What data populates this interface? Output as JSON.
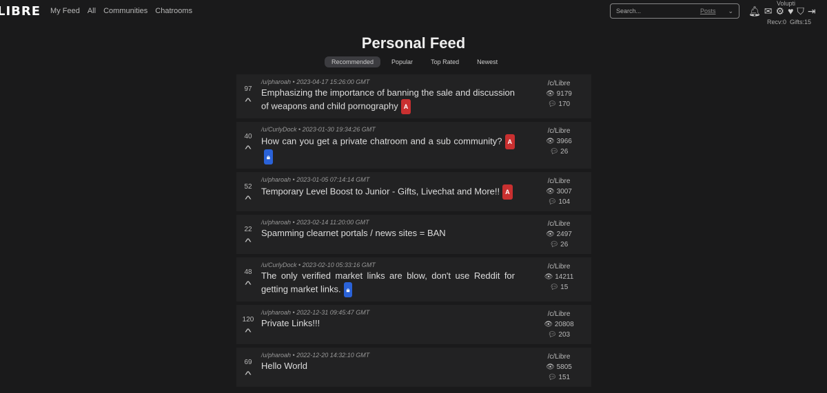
{
  "nav": {
    "logo": "LIBRE",
    "links": [
      "My Feed",
      "All",
      "Communities",
      "Chatrooms"
    ]
  },
  "search": {
    "placeholder": "Search...",
    "scope": "Posts"
  },
  "user": {
    "name": "Volupti",
    "recv": "Recv:0",
    "gifts": "Gifts:15"
  },
  "page": {
    "title": "Personal Feed",
    "tabs": [
      "Recommended",
      "Popular",
      "Top Rated",
      "Newest"
    ],
    "active_tab": "Recommended"
  },
  "posts": [
    {
      "score": "97",
      "author": "/u/pharoah",
      "date": "2023-04-17 15:26:00 GMT",
      "title": "Emphasizing the importance of banning the sale and discussion of weapons and child pornography",
      "badges": [
        "A"
      ],
      "community": "/c/Libre",
      "views": "9179",
      "comments": "170"
    },
    {
      "score": "40",
      "author": "/u/CurlyDock",
      "date": "2023-01-30 19:34:26 GMT",
      "title": "How can you get a private chatroom and a sub community?",
      "badges": [
        "A",
        "lock"
      ],
      "community": "/c/Libre",
      "views": "3966",
      "comments": "26"
    },
    {
      "score": "52",
      "author": "/u/pharoah",
      "date": "2023-01-05 07:14:14 GMT",
      "title": "Temporary Level Boost to Junior - Gifts, Livechat and More!!",
      "badges": [
        "A"
      ],
      "community": "/c/Libre",
      "views": "3007",
      "comments": "104"
    },
    {
      "score": "22",
      "author": "/u/pharoah",
      "date": "2023-02-14 11:20:00 GMT",
      "title": "Spamming clearnet portals / news sites = BAN",
      "badges": [],
      "community": "/c/Libre",
      "views": "2497",
      "comments": "26"
    },
    {
      "score": "48",
      "author": "/u/CurlyDock",
      "date": "2023-02-10 05:33:16 GMT",
      "title": "The only verified market links are blow, don't use Reddit for getting market links.",
      "badges": [
        "lock"
      ],
      "community": "/c/Libre",
      "views": "14211",
      "comments": "15"
    },
    {
      "score": "120",
      "author": "/u/pharoah",
      "date": "2022-12-31 09:45:47 GMT",
      "title": "Private Links!!!",
      "badges": [],
      "community": "/c/Libre",
      "views": "20808",
      "comments": "203"
    },
    {
      "score": "69",
      "author": "/u/pharoah",
      "date": "2022-12-20 14:32:10 GMT",
      "title": "Hello World",
      "badges": [],
      "community": "/c/Libre",
      "views": "5805",
      "comments": "151"
    }
  ],
  "colors": {
    "badge_admin": "#c93030",
    "badge_lock": "#2a62d8",
    "background": "#1a1a1b"
  }
}
